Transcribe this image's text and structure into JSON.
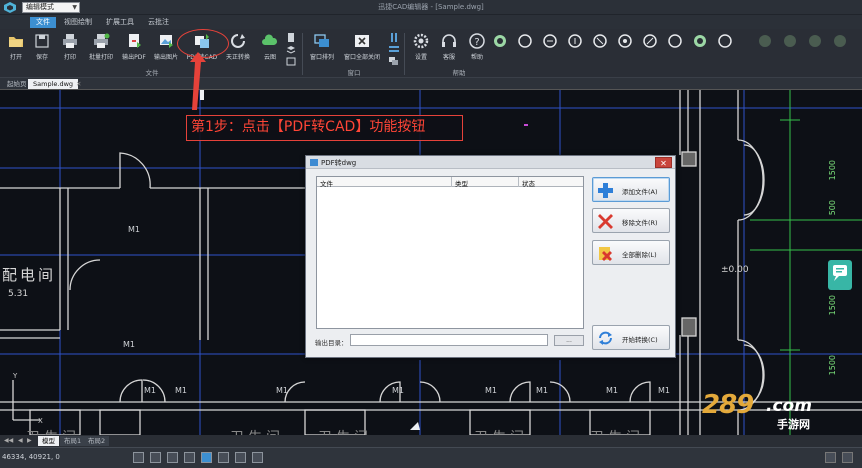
{
  "titlebar": {
    "mode_select": "编辑模式",
    "window_title": "迅捷CAD编辑器 - [Sample.dwg]"
  },
  "menu_tabs": [
    "文件",
    "视图绘制",
    "扩展工具",
    "云批注"
  ],
  "ribbon": {
    "buttons": [
      "打开",
      "保存",
      "打印",
      "批量打印",
      "输出PDF",
      "输出图片",
      "PDF转CAD",
      "天正转换",
      "云图",
      "窗口排列",
      "窗口全部关闭",
      "设置",
      "客服",
      "帮助"
    ],
    "groups": [
      "文件",
      "窗口",
      "帮助"
    ]
  },
  "doc_tabs": [
    "起始页",
    "Sample.dwg"
  ],
  "callout": "第1步：点击【PDF转CAD】功能按钮",
  "canvas": {
    "m1_labels": [
      "M1",
      "M1",
      "M1",
      "M1",
      "M1",
      "M1",
      "M1",
      "M1",
      "M1",
      "M1"
    ],
    "room_name": "配电间",
    "room_value": "5.31",
    "toilets": [
      "卫生间",
      "卫生间",
      "卫生间",
      "卫生间",
      "卫生间"
    ],
    "dims": [
      "1500",
      "500",
      "1500",
      "1500"
    ],
    "level": "±0.00",
    "faint_number": "4000",
    "ucs": {
      "y": "Y",
      "x": "X"
    }
  },
  "dialog": {
    "title": "PDF转dwg",
    "columns": [
      "文件",
      "类型",
      "状态"
    ],
    "buttons": {
      "add": "添加文件(A)",
      "remove": "移除文件(R)",
      "remove_all": "全部删除(L)",
      "convert": "开始转换(C)"
    },
    "output_dir_label": "输出目录：",
    "output_dir_value": "",
    "browse": "...",
    "close": "✕"
  },
  "layout_tabs": [
    "模型",
    "布局1",
    "布局2"
  ],
  "status": {
    "coords": "46334, 40921, 0"
  },
  "watermark": {
    "num": "289",
    "com": ".com",
    "cn": "手游网"
  },
  "colors": {
    "accent": "#3c8fd1",
    "callout": "#e5423a",
    "cad_green": "#35c04a",
    "dims": "#7ce37c"
  }
}
